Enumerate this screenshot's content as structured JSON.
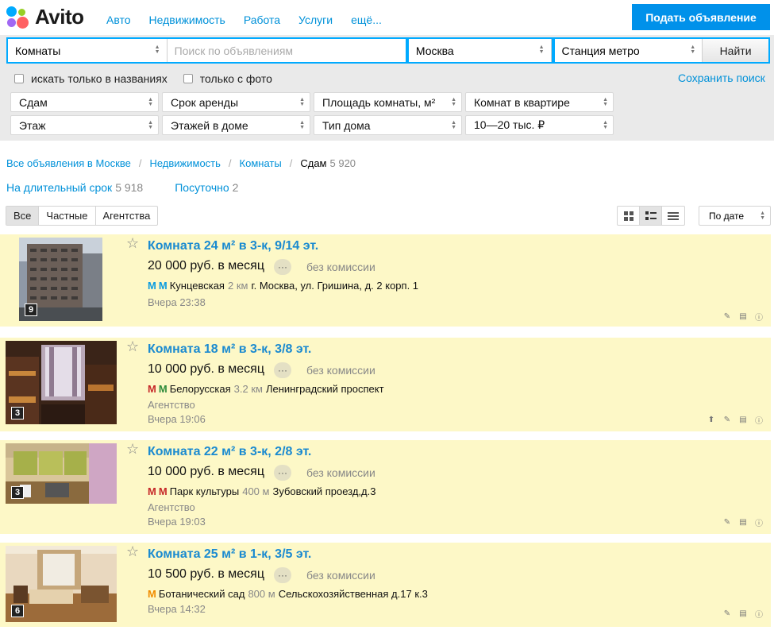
{
  "header": {
    "logo_text": "Avito",
    "nav": [
      "Авто",
      "Недвижимость",
      "Работа",
      "Услуги",
      "ещё..."
    ],
    "post_button": "Подать объявление"
  },
  "search": {
    "category": "Комнаты",
    "query_placeholder": "Поиск по объявлениям",
    "city": "Москва",
    "metro": "Станция метро",
    "find_button": "Найти",
    "check_titles": "искать только в названиях",
    "check_photo": "только с фото",
    "save_search": "Сохранить поиск",
    "filters": {
      "deal": "Сдам",
      "term": "Срок аренды",
      "area": "Площадь комнаты, м²",
      "rooms": "Комнат в квартире",
      "floor": "Этаж",
      "floors": "Этажей в доме",
      "house_type": "Тип дома",
      "price": "10—20 тыс. ₽"
    }
  },
  "breadcrumbs": {
    "items": [
      "Все объявления в Москве",
      "Недвижимость",
      "Комнаты"
    ],
    "current": "Сдам",
    "current_count": "5 920"
  },
  "subcategories": [
    {
      "label": "На длительный срок",
      "count": "5 918"
    },
    {
      "label": "Посуточно",
      "count": "2"
    }
  ],
  "tabs": [
    "Все",
    "Частные",
    "Агентства"
  ],
  "sort": "По дате",
  "colors": {
    "accent": "#0091d9",
    "highlight": "#fdf8c7",
    "metro_blue": "#0a9be0",
    "metro_red": "#c62828",
    "metro_green": "#2e8b3a",
    "metro_orange": "#f08c00"
  },
  "listings": [
    {
      "title": "Комната 24 м² в 3-к, 9/14 эт.",
      "price": "20 000 руб. в месяц",
      "commission": "без комиссии",
      "metro": "Кунцевская",
      "distance": "2 км",
      "address": "г. Москва, ул. Гришина, д. 2 корп. 1",
      "agency": "",
      "date": "Вчера 23:38",
      "photo_count": "9"
    },
    {
      "title": "Комната 18 м² в 3-к, 3/8 эт.",
      "price": "10 000 руб. в месяц",
      "commission": "без комиссии",
      "metro": "Белорусская",
      "distance": "3.2 км",
      "address": "Ленинградский проспект",
      "agency": "Агентство",
      "date": "Вчера 19:06",
      "photo_count": "3"
    },
    {
      "title": "Комната 22 м² в 3-к, 2/8 эт.",
      "price": "10 000 руб. в месяц",
      "commission": "без комиссии",
      "metro": "Парк культуры",
      "distance": "400 м",
      "address": "Зубовский проезд,д.3",
      "agency": "Агентство",
      "date": "Вчера 19:03",
      "photo_count": "3"
    },
    {
      "title": "Комната 25 м² в 1-к, 3/5 эт.",
      "price": "10 500 руб. в месяц",
      "commission": "без комиссии",
      "metro": "Ботанический сад",
      "distance": "800 м",
      "address": "Сельскохозяйственная д.17 к.3",
      "agency": "",
      "date": "Вчера 14:32",
      "photo_count": "6"
    }
  ]
}
